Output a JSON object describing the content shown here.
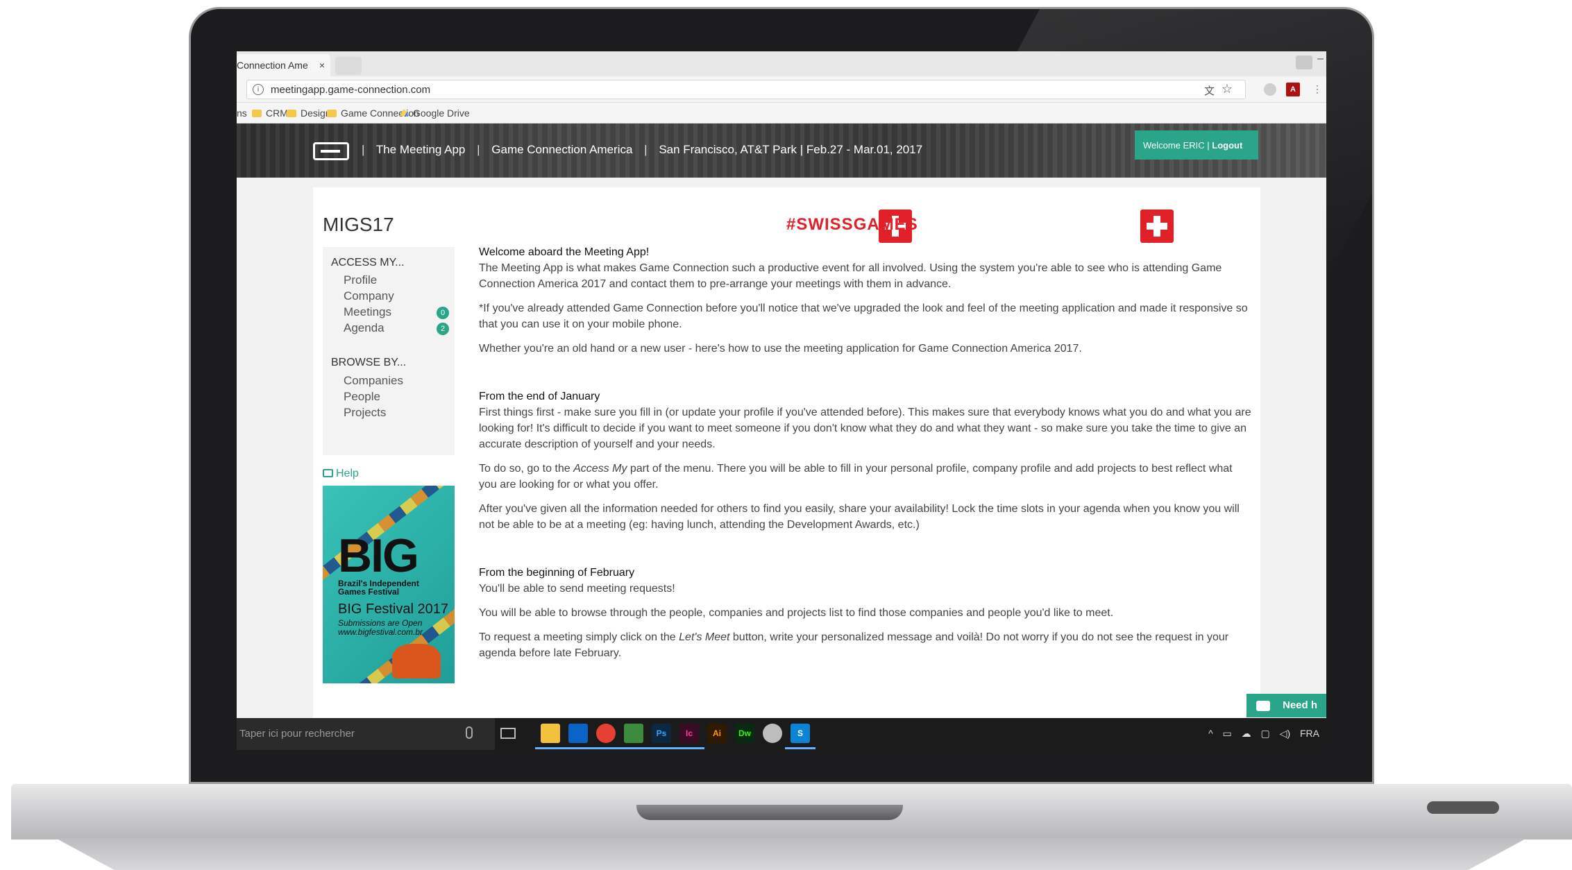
{
  "browser": {
    "tab_title": "Connection Ame",
    "tab_close": "×",
    "url": "meetingapp.game-connection.com",
    "bookmarks": [
      "ns",
      "CRM",
      "Design",
      "Game Connection",
      "Google Drive"
    ]
  },
  "site_header": {
    "app_name": "The Meeting App",
    "event": "Game Connection America",
    "venue": "San Francisco, AT&T Park | Feb.27 - Mar.01, 2017",
    "separator": "|",
    "welcome": "Welcome ERIC",
    "logout": "Logout"
  },
  "page": {
    "title": "MIGS17",
    "banner": "#SWISSGAMES"
  },
  "sidebar": {
    "access_heading": "ACCESS MY...",
    "access_items": [
      "Profile",
      "Company",
      "Meetings",
      "Agenda"
    ],
    "meetings_badge": "0",
    "agenda_badge": "2",
    "browse_heading": "BROWSE BY...",
    "browse_items": [
      "Companies",
      "People",
      "Projects"
    ],
    "help": "Help"
  },
  "ad": {
    "big": "BIG",
    "subtitle": "Brazil's Independent Games Festival",
    "festival": "BIG Festival 2017",
    "small1": "Submissions are Open",
    "small2": "www.bigfestival.com.br"
  },
  "main": {
    "welcome_heading": "Welcome aboard the Meeting App!",
    "welcome_p1": "The Meeting App is what makes Game Connection such a productive event for all involved. Using the system you're able to see who is attending Game Connection America 2017 and contact them to pre-arrange your meetings with them in advance.",
    "welcome_p2": "*If you've already attended Game Connection before you'll notice that we've upgraded the look and feel of the meeting application and made it responsive so that you can use it on your mobile phone.",
    "welcome_p3": "Whether you're an old hand or a new user - here's how to use the meeting application for Game Connection America 2017.",
    "jan_heading": "From the end of January",
    "jan_p1": "First things first - make sure you fill in (or update your profile if you've attended before). This makes sure that everybody knows what you do and what you are looking for! It's difficult to decide if you want to meet someone if you don't know what they do and what they want - so make sure you take the time to give an accurate description of yourself and your needs.",
    "jan_p2_a": "To do so, go to the ",
    "jan_p2_em": "Access My",
    "jan_p2_b": " part of the menu. There you will be able to fill in your personal profile, company profile and add projects to best reflect what you are looking for or what you offer.",
    "jan_p3": "After you've given all the information needed for others to find you easily, share your availability! Lock the time slots in your agenda when you know you will not be able to be at a meeting (eg: having lunch, attending the Development Awards, etc.)",
    "feb_heading": "From the beginning of February",
    "feb_p1": "You'll be able to send meeting requests!",
    "feb_p2": "You will be able to browse through the people, companies and projects list to find those companies and people you'd like to meet.",
    "feb_p3_a": "To request a meeting simply click on the ",
    "feb_p3_em": "Let's Meet",
    "feb_p3_b": " button, write your personalized message and voilà! Do not worry if you do not see the request in your agenda before late February."
  },
  "need_help": "Need h",
  "taskbar": {
    "search_placeholder": "Taper ici pour rechercher",
    "apps": [
      "Ps",
      "Ic",
      "Ai",
      "Dw",
      "S"
    ],
    "lang": "FRA"
  },
  "colors": {
    "accent": "#2aa58a",
    "swiss_red": "#e22027"
  }
}
